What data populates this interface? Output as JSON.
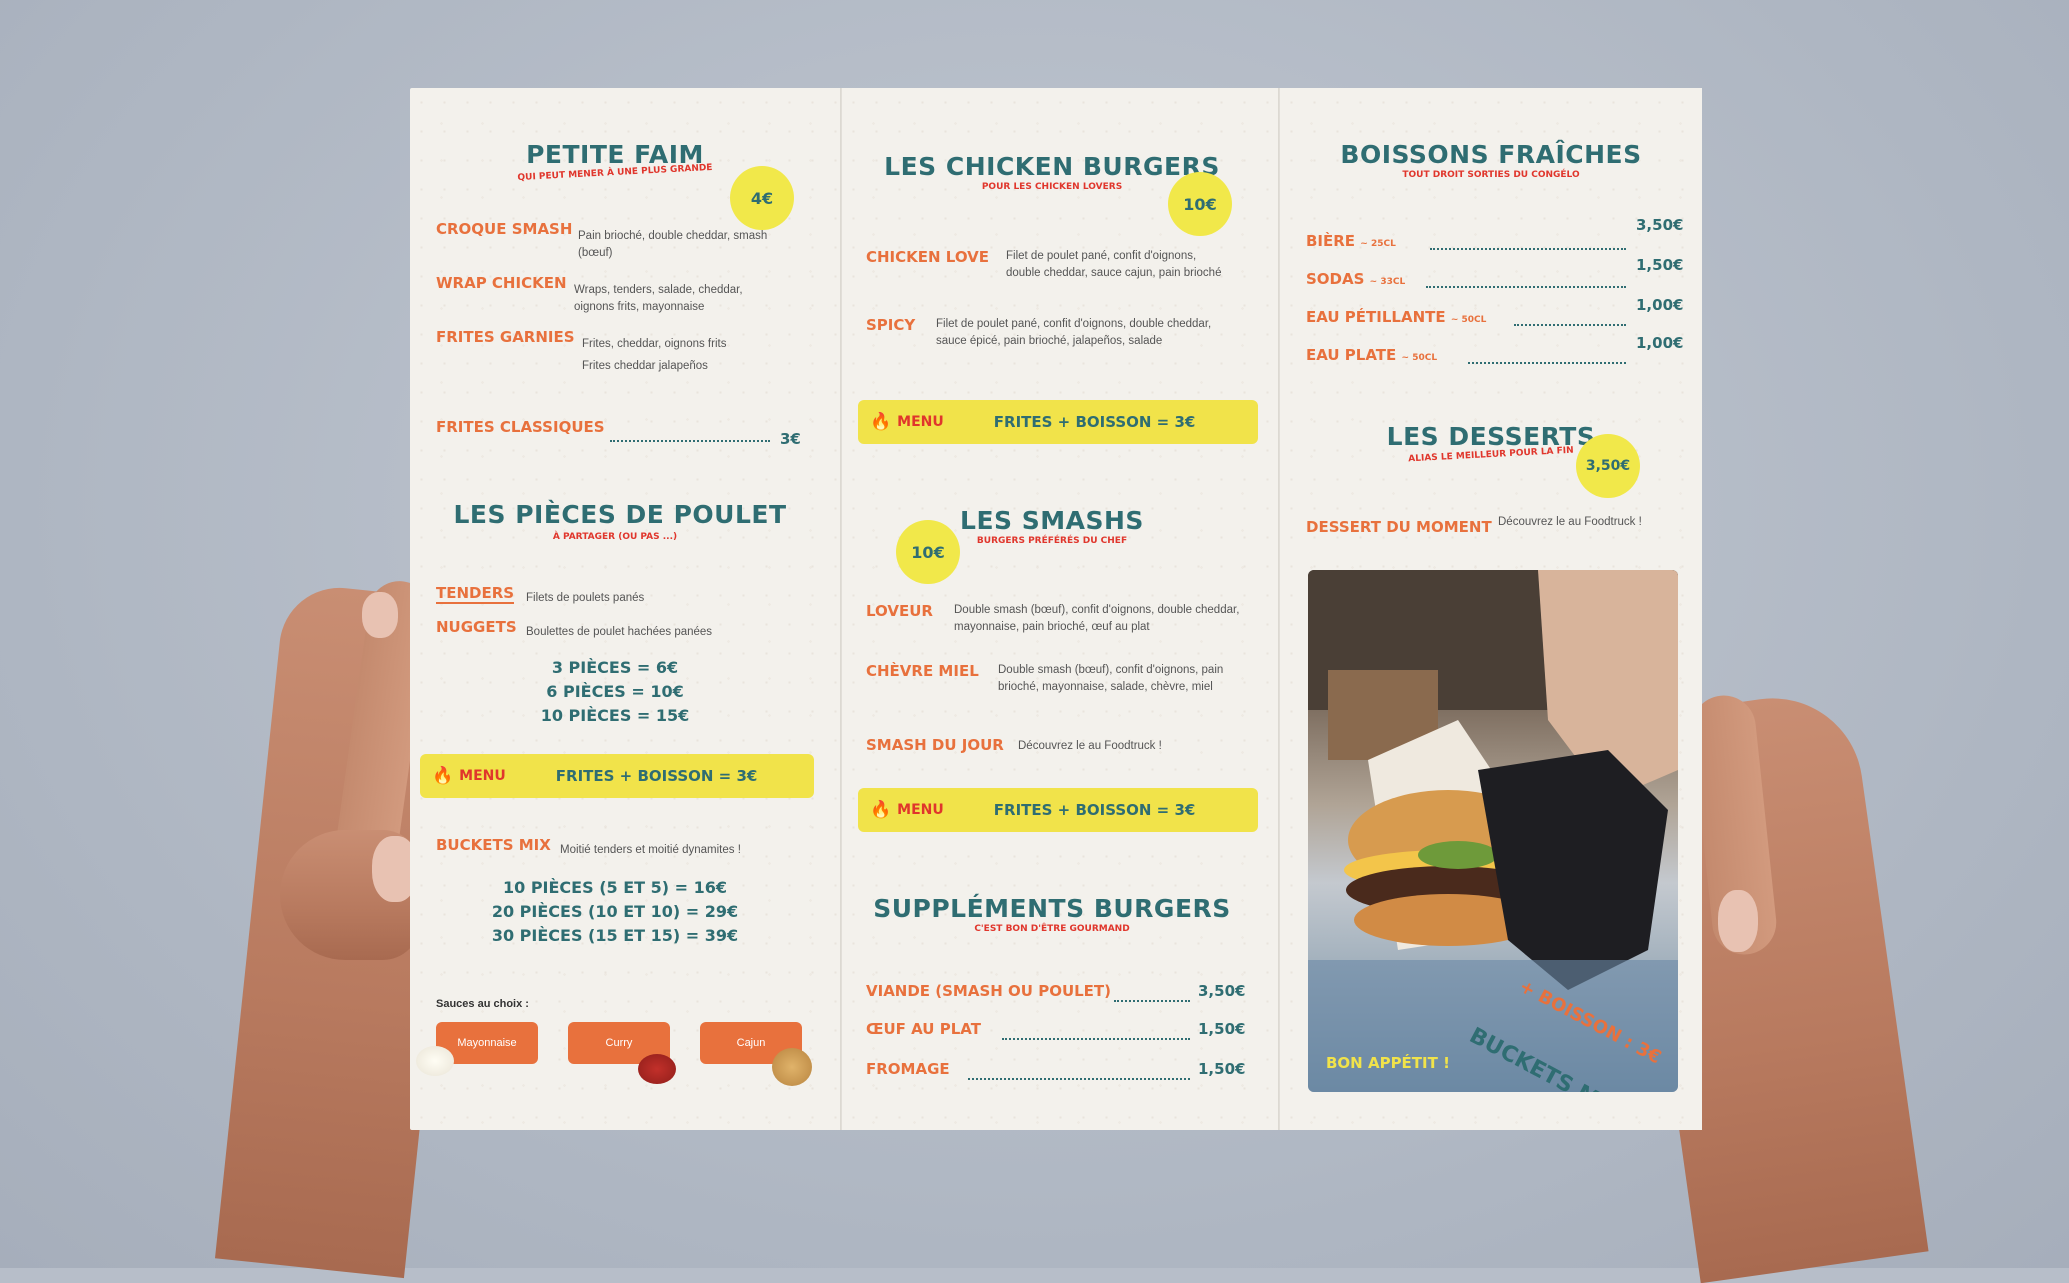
{
  "panel1": {
    "petite_faim": {
      "title": "PETITE FAIM",
      "subtitle": "QUI PEUT MENER À UNE PLUS GRANDE",
      "badge": "4€"
    },
    "items": [
      {
        "name": "CROQUE SMASH",
        "desc": "Pain brioché, double cheddar, smash (bœuf)"
      },
      {
        "name": "WRAP CHICKEN",
        "desc": "Wraps, tenders, salade, cheddar, oignons frits, mayonnaise"
      },
      {
        "name": "FRITES GARNIES",
        "desc": "Frites, cheddar, oignons frits",
        "desc2": "Frites cheddar jalapeños"
      }
    ],
    "frites_classiques": {
      "name": "FRITES CLASSIQUES",
      "price": "3€"
    },
    "poulet": {
      "title": "LES PIÈCES DE POULET",
      "subtitle": "À PARTAGER (OU PAS ...)"
    },
    "tenders": {
      "name": "TENDERS",
      "desc": "Filets de poulets panés"
    },
    "nuggets": {
      "name": "NUGGETS",
      "desc": "Boulettes de poulet hachées panées"
    },
    "poulet_prices": [
      "3 PIÈCES = 6€",
      "6 PIÈCES = 10€",
      "10 PIÈCES = 15€"
    ],
    "menu": {
      "label": "MENU",
      "value": "FRITES + BOISSON = 3€"
    },
    "buckets": {
      "name": "BUCKETS MIX",
      "desc": "Moitié tenders et moitié dynamites !"
    },
    "buckets_prices": [
      "10 PIÈCES (5 ET 5) = 16€",
      "20 PIÈCES (10 ET 10) = 29€",
      "30 PIÈCES (15 ET 15) = 39€"
    ],
    "sauces_title": "Sauces au choix :",
    "sauces": [
      "Mayonnaise",
      "Curry",
      "Cajun"
    ]
  },
  "panel2": {
    "chicken": {
      "title": "LES CHICKEN BURGERS",
      "subtitle": "POUR LES CHICKEN LOVERS",
      "badge": "10€"
    },
    "chicken_items": [
      {
        "name": "CHICKEN LOVE",
        "desc": "Filet de poulet pané, confit d'oignons, double cheddar, sauce cajun, pain brioché"
      },
      {
        "name": "SPICY",
        "desc": "Filet de poulet pané, confit d'oignons, double cheddar, sauce épicé, pain brioché, jalapeños, salade"
      }
    ],
    "menu1": {
      "label": "MENU",
      "value": "FRITES + BOISSON = 3€"
    },
    "smashs": {
      "title": "LES SMASHS",
      "subtitle": "BURGERS PRÉFÉRÉS DU CHEF",
      "badge": "10€"
    },
    "smash_items": [
      {
        "name": "LOVEUR",
        "desc": "Double smash (bœuf), confit d'oignons, double cheddar, mayonnaise, pain brioché, œuf au plat"
      },
      {
        "name": "CHÈVRE MIEL",
        "desc": "Double smash (bœuf), confit d'oignons, pain brioché, mayonnaise, salade, chèvre, miel"
      },
      {
        "name": "SMASH DU JOUR",
        "desc": "Découvrez le au Foodtruck !"
      }
    ],
    "menu2": {
      "label": "MENU",
      "value": "FRITES + BOISSON = 3€"
    },
    "supplements": {
      "title": "SUPPLÉMENTS BURGERS",
      "subtitle": "C'EST BON D'ÊTRE GOURMAND"
    },
    "supp_items": [
      {
        "name": "VIANDE (SMASH OU POULET)",
        "price": "3,50€"
      },
      {
        "name": "ŒUF AU PLAT",
        "price": "1,50€"
      },
      {
        "name": "FROMAGE",
        "price": "1,50€"
      }
    ]
  },
  "panel3": {
    "boissons": {
      "title": "BOISSONS FRAÎCHES",
      "subtitle": "TOUT DROIT SORTIES DU CONGÉLO"
    },
    "drinks": [
      {
        "name": "BIÈRE",
        "size": "~ 25CL",
        "price": "3,50€"
      },
      {
        "name": "SODAS",
        "size": "~ 33CL",
        "price": "1,50€"
      },
      {
        "name": "EAU PÉTILLANTE",
        "size": "~ 50CL",
        "price": "1,00€"
      },
      {
        "name": "EAU PLATE",
        "size": "~ 50CL",
        "price": "1,00€"
      }
    ],
    "desserts": {
      "title": "LES DESSERTS",
      "subtitle": "ALIAS LE MEILLEUR POUR LA FIN",
      "badge": "3,50€"
    },
    "dessert_item": {
      "name": "DESSERT DU MOMENT",
      "desc": "Découvrez le au Foodtruck !"
    },
    "photo_caption": "BON APPÉTIT !",
    "photo_sign1": "BUCKETS MIX",
    "photo_sign2": "+ BOISSON : 3€"
  },
  "colors": {
    "teal": "#2f6d72",
    "orange": "#e8713d",
    "red": "#e0362c",
    "yellow": "#f1e34a",
    "paper": "#f3f1ec"
  }
}
